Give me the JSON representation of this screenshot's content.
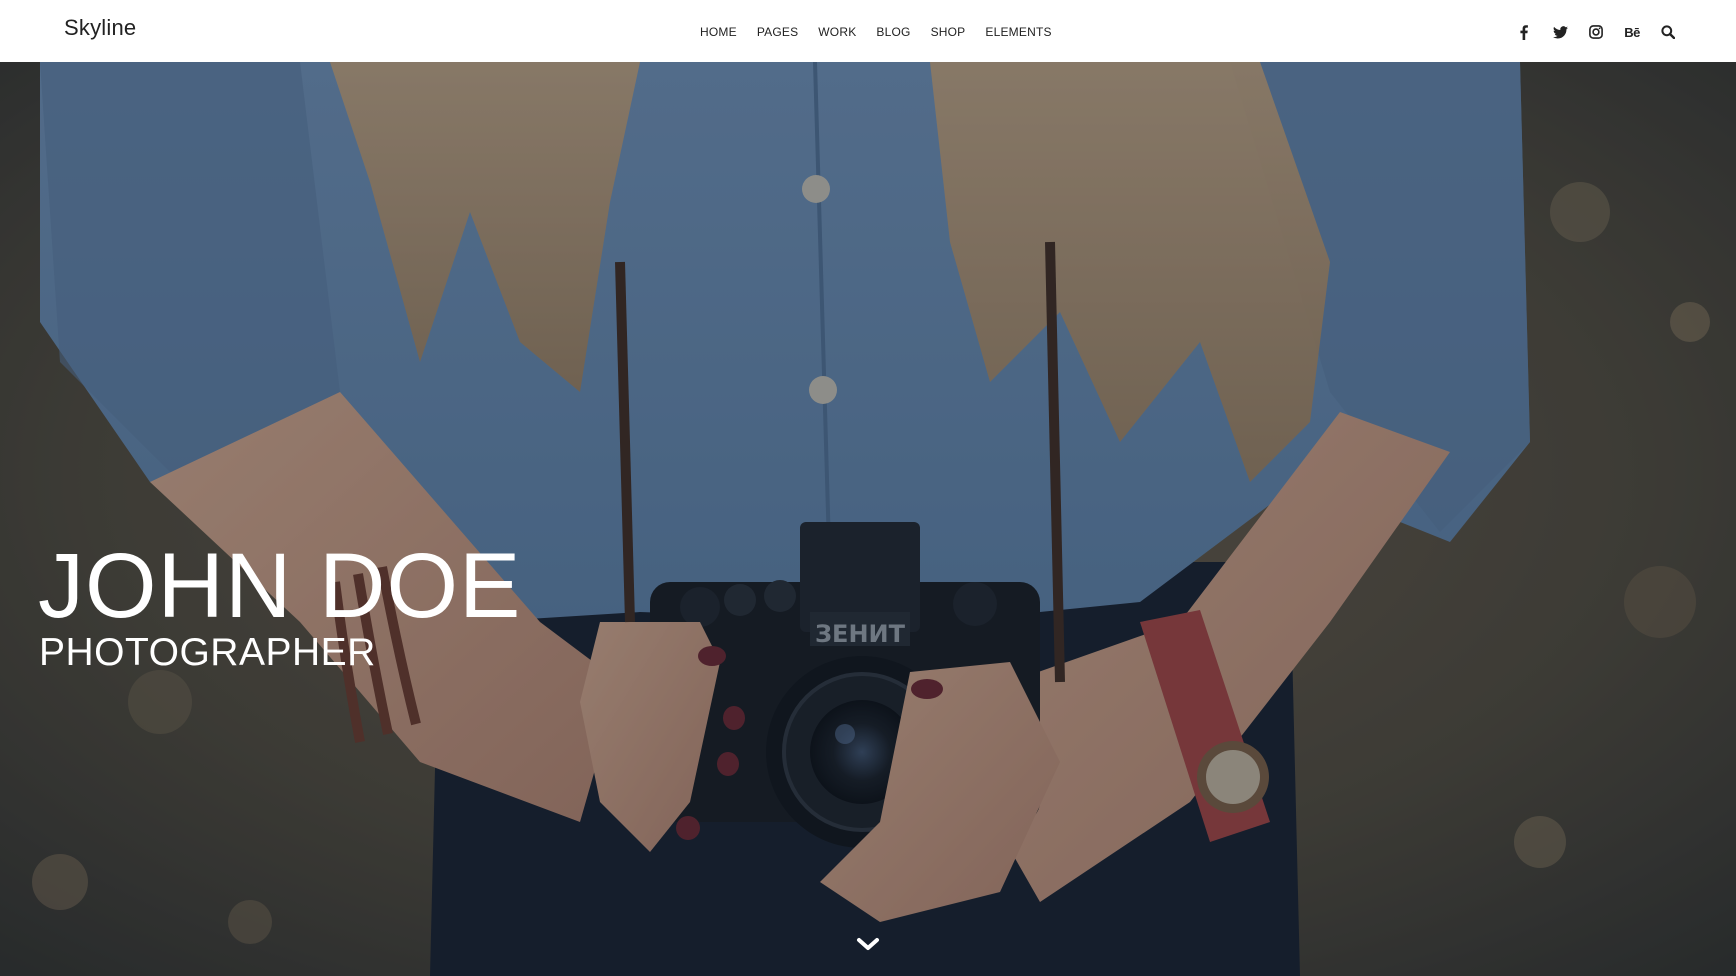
{
  "header": {
    "logo": "Skyline",
    "nav": [
      {
        "label": "HOME"
      },
      {
        "label": "PAGES"
      },
      {
        "label": "WORK"
      },
      {
        "label": "BLOG"
      },
      {
        "label": "SHOP"
      },
      {
        "label": "ELEMENTS"
      }
    ],
    "social_icons": [
      "facebook-icon",
      "twitter-icon",
      "instagram-icon",
      "behance-icon",
      "search-icon"
    ],
    "behance_text": "Bē"
  },
  "hero": {
    "title": "JOHN DOE",
    "subtitle": "PHOTOGRAPHER",
    "camera_brand": "ЗЕНИТ",
    "scroll_icon": "chevron-down-icon"
  },
  "colors": {
    "header_bg": "#ffffff",
    "text_dark": "#222222",
    "hero_text": "#ffffff",
    "overlay": "#1d2a3a"
  }
}
